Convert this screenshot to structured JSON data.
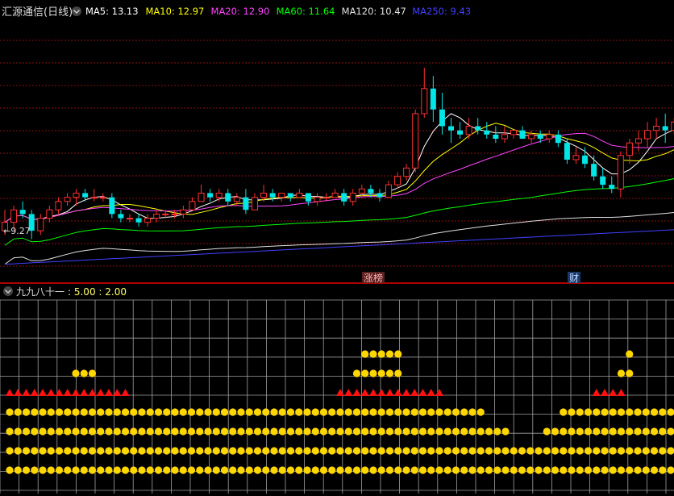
{
  "header": {
    "title": "汇源通信(日线)",
    "indicators": [
      {
        "label": "MA5: 13.13",
        "color": "#ffffff"
      },
      {
        "label": "MA10: 12.97",
        "color": "#ffff00"
      },
      {
        "label": "MA20: 12.90",
        "color": "#ff44ff"
      },
      {
        "label": "MA60: 11.64",
        "color": "#00ff00"
      },
      {
        "label": "MA120: 10.47",
        "color": "#e0e0e0"
      },
      {
        "label": "MA250: 9.43",
        "color": "#4040ff"
      }
    ]
  },
  "markers": {
    "low_label": "←9.27",
    "tag1": "涨榜",
    "tag2": "财"
  },
  "sub_panel": {
    "title": "九九八十一",
    "params": ": 5.00  : 2.00"
  },
  "colors": {
    "up": "#ff3030",
    "down": "#00e6e6",
    "grid_red": "#8a1010",
    "sub_grid": "#a0a0a0",
    "dot": "#ffd700",
    "triangle": "#ff1010"
  },
  "chart_data": [
    {
      "type": "candlestick",
      "price_range": [
        8.4,
        14.3
      ],
      "candles": [
        [
          9.4,
          9.9,
          9.3,
          9.6
        ],
        [
          9.6,
          10.0,
          9.4,
          9.9
        ],
        [
          9.9,
          10.1,
          9.7,
          9.8
        ],
        [
          9.8,
          9.9,
          9.2,
          9.4
        ],
        [
          9.4,
          9.8,
          9.3,
          9.7
        ],
        [
          9.7,
          10.0,
          9.6,
          9.9
        ],
        [
          9.9,
          10.2,
          9.8,
          10.1
        ],
        [
          10.1,
          10.3,
          10.0,
          10.2
        ],
        [
          10.2,
          10.4,
          10.0,
          10.3
        ],
        [
          10.3,
          10.4,
          10.1,
          10.2
        ],
        [
          10.2,
          10.4,
          10.1,
          10.2
        ],
        [
          10.2,
          10.3,
          10.1,
          10.2
        ],
        [
          10.2,
          10.3,
          9.7,
          9.8
        ],
        [
          9.8,
          9.9,
          9.6,
          9.7
        ],
        [
          9.7,
          9.8,
          9.6,
          9.7
        ],
        [
          9.7,
          9.8,
          9.5,
          9.6
        ],
        [
          9.6,
          9.8,
          9.5,
          9.7
        ],
        [
          9.7,
          9.9,
          9.6,
          9.8
        ],
        [
          9.8,
          9.9,
          9.7,
          9.8
        ],
        [
          9.8,
          9.9,
          9.7,
          9.8
        ],
        [
          9.8,
          10.0,
          9.7,
          9.9
        ],
        [
          9.9,
          10.2,
          9.9,
          10.1
        ],
        [
          10.1,
          10.5,
          10.1,
          10.3
        ],
        [
          10.3,
          10.4,
          10.1,
          10.2
        ],
        [
          10.2,
          10.4,
          10.1,
          10.3
        ],
        [
          10.3,
          10.4,
          10.0,
          10.1
        ],
        [
          10.1,
          10.3,
          10.0,
          10.2
        ],
        [
          10.2,
          10.4,
          9.8,
          9.9
        ],
        [
          9.9,
          10.3,
          9.9,
          10.2
        ],
        [
          10.2,
          10.5,
          10.1,
          10.3
        ],
        [
          10.3,
          10.4,
          10.1,
          10.2
        ],
        [
          10.2,
          10.3,
          10.1,
          10.3
        ],
        [
          10.3,
          10.3,
          10.1,
          10.2
        ],
        [
          10.2,
          10.4,
          10.2,
          10.3
        ],
        [
          10.3,
          10.3,
          10.0,
          10.1
        ],
        [
          10.1,
          10.3,
          10.0,
          10.2
        ],
        [
          10.2,
          10.3,
          10.1,
          10.2
        ],
        [
          10.2,
          10.4,
          10.2,
          10.3
        ],
        [
          10.3,
          10.4,
          10.0,
          10.1
        ],
        [
          10.1,
          10.4,
          10.0,
          10.3
        ],
        [
          10.3,
          10.5,
          10.2,
          10.4
        ],
        [
          10.4,
          10.5,
          10.2,
          10.3
        ],
        [
          10.3,
          10.4,
          10.1,
          10.2
        ],
        [
          10.2,
          10.6,
          10.2,
          10.5
        ],
        [
          10.5,
          10.8,
          10.4,
          10.7
        ],
        [
          10.7,
          11.0,
          10.6,
          10.9
        ],
        [
          10.9,
          12.3,
          10.8,
          12.2
        ],
        [
          12.2,
          13.3,
          12.1,
          12.8
        ],
        [
          12.8,
          13.1,
          12.0,
          12.3
        ],
        [
          12.3,
          12.7,
          11.7,
          11.9
        ],
        [
          11.9,
          12.1,
          11.5,
          11.8
        ],
        [
          11.8,
          12.0,
          11.6,
          11.7
        ],
        [
          11.7,
          12.1,
          11.6,
          11.9
        ],
        [
          11.9,
          12.1,
          11.7,
          11.8
        ],
        [
          11.8,
          12.0,
          11.6,
          11.7
        ],
        [
          11.7,
          11.9,
          11.5,
          11.6
        ],
        [
          11.6,
          11.9,
          11.5,
          11.7
        ],
        [
          11.7,
          11.8,
          11.6,
          11.8
        ],
        [
          11.8,
          11.9,
          11.6,
          11.6
        ],
        [
          11.6,
          11.8,
          11.5,
          11.7
        ],
        [
          11.7,
          11.8,
          11.5,
          11.6
        ],
        [
          11.6,
          11.8,
          11.5,
          11.7
        ],
        [
          11.7,
          11.8,
          11.4,
          11.5
        ],
        [
          11.5,
          11.6,
          11.0,
          11.1
        ],
        [
          11.1,
          11.4,
          11.0,
          11.2
        ],
        [
          11.2,
          11.4,
          10.9,
          11.0
        ],
        [
          11.0,
          11.2,
          10.6,
          10.7
        ],
        [
          10.7,
          10.9,
          10.4,
          10.5
        ],
        [
          10.5,
          10.7,
          10.3,
          10.4
        ],
        [
          10.4,
          11.3,
          10.2,
          11.2
        ],
        [
          11.2,
          11.6,
          11.0,
          11.5
        ],
        [
          11.5,
          11.8,
          11.3,
          11.6
        ],
        [
          11.6,
          12.0,
          11.4,
          11.8
        ],
        [
          11.8,
          12.1,
          11.6,
          11.9
        ],
        [
          11.9,
          12.2,
          11.5,
          11.8
        ],
        [
          11.8,
          12.1,
          11.7,
          12.0
        ],
        [
          12.0,
          13.2,
          11.9,
          12.9
        ],
        [
          12.9,
          14.1,
          12.8,
          13.9
        ],
        [
          13.9,
          14.0,
          13.4,
          13.6
        ],
        [
          13.6,
          14.3,
          13.3,
          14.1
        ],
        [
          14.1,
          14.2,
          13.5,
          13.8
        ]
      ]
    },
    {
      "type": "dot-matrix",
      "rows": [
        {
          "level": 1,
          "shape": "circle",
          "cells": [
            [
              0,
              80
            ]
          ]
        },
        {
          "level": 2,
          "shape": "circle",
          "cells": [
            [
              0,
              80
            ]
          ]
        },
        {
          "level": 3,
          "shape": "circle",
          "cells": [
            [
              0,
              60
            ],
            [
              65,
              80
            ]
          ]
        },
        {
          "level": 4,
          "shape": "circle",
          "cells": [
            [
              0,
              57
            ],
            [
              67,
              80
            ]
          ]
        },
        {
          "level": 5,
          "shape": "triangle",
          "cells": [
            [
              0,
              14
            ],
            [
              40,
              52
            ],
            [
              71,
              74
            ]
          ]
        },
        {
          "level": 6,
          "shape": "circle",
          "cells": [
            [
              8,
              10
            ],
            [
              42,
              47
            ],
            [
              74,
              75
            ]
          ]
        },
        {
          "level": 7,
          "shape": "circle",
          "cells": [
            [
              43,
              47
            ],
            [
              75,
              75
            ]
          ]
        }
      ]
    }
  ]
}
